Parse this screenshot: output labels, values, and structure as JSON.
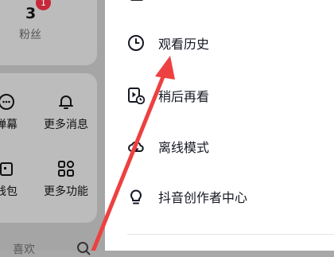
{
  "left_panel": {
    "follow_count": "3",
    "follow_badge": "1",
    "follow_label": "粉丝",
    "shortcuts": [
      {
        "label": "弹幕",
        "icon": "danmu-icon"
      },
      {
        "label": "更多消息",
        "icon": "bell-icon"
      },
      {
        "label": "钱包",
        "icon": "wallet-icon"
      },
      {
        "label": "更多功能",
        "icon": "apps-icon"
      }
    ],
    "favorites_label": "喜欢"
  },
  "drawer_menu": {
    "items": [
      {
        "label": "观看历史",
        "icon": "clock-icon"
      },
      {
        "label": "稍后再看",
        "icon": "watch-later-icon"
      },
      {
        "label": "离线模式",
        "icon": "cloud-offline-icon"
      },
      {
        "label": "抖音创作者中心",
        "icon": "lightbulb-icon"
      }
    ]
  },
  "annotation": {
    "arrow_color": "#ee4040"
  }
}
